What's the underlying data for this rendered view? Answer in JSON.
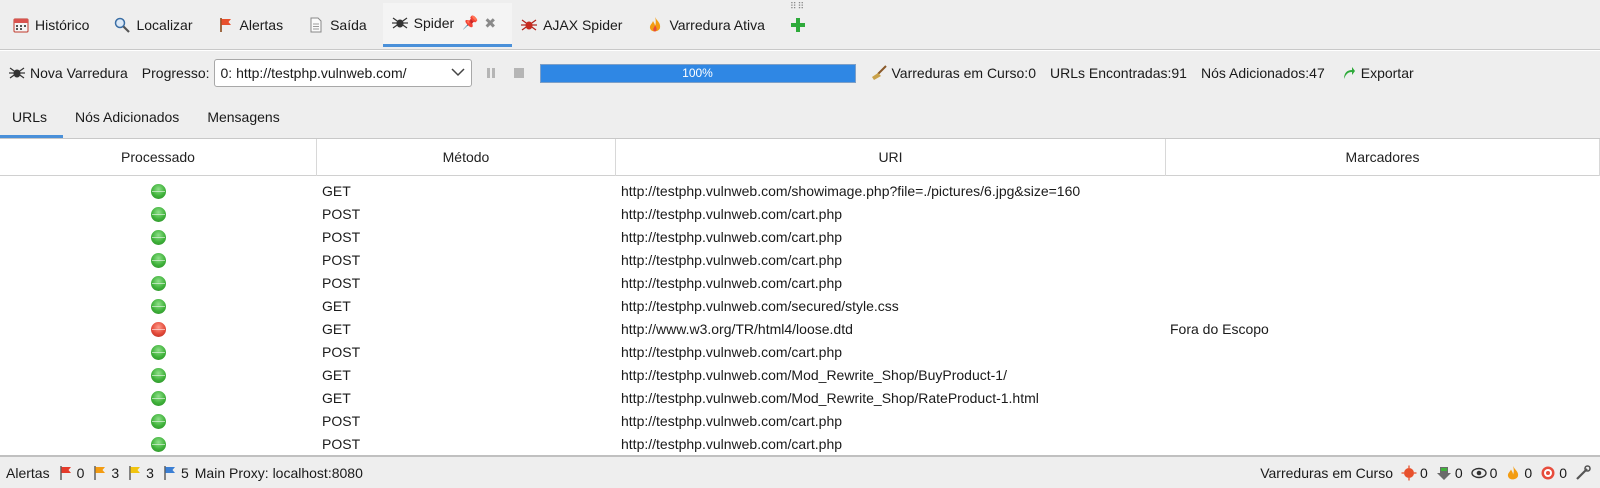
{
  "tabs": [
    {
      "label": "Histórico",
      "icon": "history-icon"
    },
    {
      "label": "Localizar",
      "icon": "search-icon"
    },
    {
      "label": "Alertas",
      "icon": "alert-flag-icon"
    },
    {
      "label": "Saída",
      "icon": "output-icon"
    },
    {
      "label": "Spider",
      "icon": "spider-icon",
      "active": true
    },
    {
      "label": "AJAX Spider",
      "icon": "ajax-spider-icon"
    },
    {
      "label": "Varredura Ativa",
      "icon": "active-scan-flame-icon"
    }
  ],
  "toolbar": {
    "new_scan_label": "Nova Varredura",
    "progress_label": "Progresso:",
    "scan_select_value": "0: http://testphp.vulnweb.com/",
    "progress_percent": 100,
    "progress_text": "100%",
    "scans_running_label": "Varreduras em Curso:",
    "scans_running_value": "0",
    "urls_found_label": "URLs Encontradas:",
    "urls_found_value": "91",
    "nodes_added_label": "Nós Adicionados:",
    "nodes_added_value": "47",
    "export_label": "Exportar"
  },
  "subtabs": [
    {
      "label": "URLs",
      "active": true
    },
    {
      "label": "Nós Adicionados"
    },
    {
      "label": "Mensagens"
    }
  ],
  "table": {
    "columns": [
      "Processado",
      "Método",
      "URI",
      "Marcadores"
    ],
    "rows": [
      {
        "status": "ok",
        "method": "GET",
        "uri": "http://testphp.vulnweb.com/showimage.php?file=./pictures/6.jpg&size=160",
        "flags": ""
      },
      {
        "status": "ok",
        "method": "POST",
        "uri": "http://testphp.vulnweb.com/cart.php",
        "flags": ""
      },
      {
        "status": "ok",
        "method": "POST",
        "uri": "http://testphp.vulnweb.com/cart.php",
        "flags": ""
      },
      {
        "status": "ok",
        "method": "POST",
        "uri": "http://testphp.vulnweb.com/cart.php",
        "flags": ""
      },
      {
        "status": "ok",
        "method": "POST",
        "uri": "http://testphp.vulnweb.com/cart.php",
        "flags": ""
      },
      {
        "status": "ok",
        "method": "GET",
        "uri": "http://testphp.vulnweb.com/secured/style.css",
        "flags": ""
      },
      {
        "status": "bad",
        "method": "GET",
        "uri": "http://www.w3.org/TR/html4/loose.dtd",
        "flags": "Fora do Escopo"
      },
      {
        "status": "ok",
        "method": "POST",
        "uri": "http://testphp.vulnweb.com/cart.php",
        "flags": ""
      },
      {
        "status": "ok",
        "method": "GET",
        "uri": "http://testphp.vulnweb.com/Mod_Rewrite_Shop/BuyProduct-1/",
        "flags": ""
      },
      {
        "status": "ok",
        "method": "GET",
        "uri": "http://testphp.vulnweb.com/Mod_Rewrite_Shop/RateProduct-1.html",
        "flags": ""
      },
      {
        "status": "ok",
        "method": "POST",
        "uri": "http://testphp.vulnweb.com/cart.php",
        "flags": ""
      },
      {
        "status": "ok",
        "method": "POST",
        "uri": "http://testphp.vulnweb.com/cart.php",
        "flags": ""
      }
    ]
  },
  "statusbar": {
    "alerts_label": "Alertas",
    "alert_counts": [
      {
        "color": "#e53b2b",
        "value": "0"
      },
      {
        "color": "#f39c12",
        "value": "3"
      },
      {
        "color": "#f1c40f",
        "value": "3"
      },
      {
        "color": "#3b7fd4",
        "value": "5"
      }
    ],
    "proxy_text": "Main Proxy: localhost:8080",
    "scans_label": "Varreduras em Curso",
    "scan_counts": [
      {
        "icon": "spider-scan-icon",
        "value": "0"
      },
      {
        "icon": "forced-browse-icon",
        "value": "0"
      },
      {
        "icon": "eye-icon",
        "value": "0"
      },
      {
        "icon": "flame-icon",
        "value": "0"
      },
      {
        "icon": "fuzzer-target-icon",
        "value": "0"
      }
    ]
  }
}
